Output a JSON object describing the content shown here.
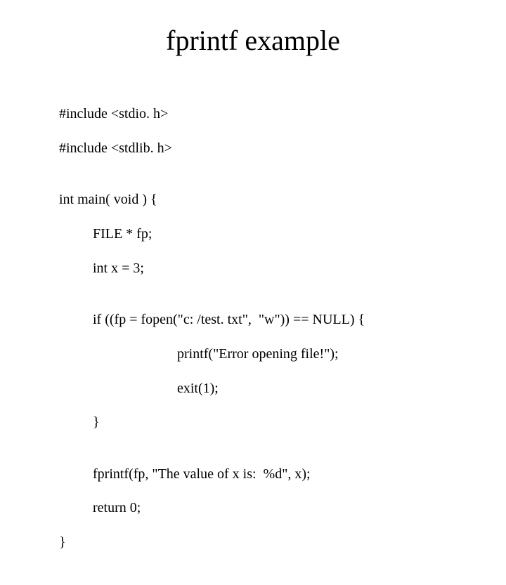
{
  "title": "fprintf example",
  "code": {
    "l1": "#include <stdio. h>",
    "l2": "#include <stdlib. h>",
    "l3": "",
    "l4": "int main( void ) {",
    "l5": "FILE * fp;",
    "l6": "int x = 3;",
    "l7": "",
    "l8": "if ((fp = fopen(\"c: /test. txt\",  \"w\")) == NULL) {",
    "l9": "printf(\"Error opening file!\");",
    "l10": "exit(1);",
    "l11": "}",
    "l12": "",
    "l13": "fprintf(fp, \"The value of x is:  %d\", x);",
    "l14": "return 0;",
    "l15": "}"
  }
}
